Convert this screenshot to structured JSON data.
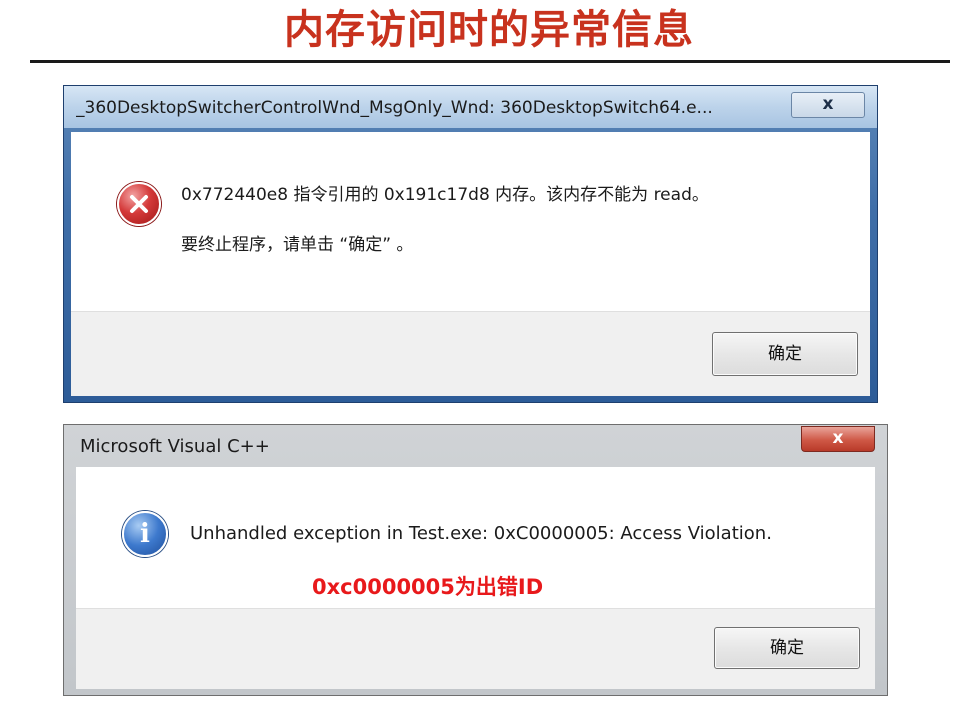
{
  "slide": {
    "title": "内存访问时的异常信息"
  },
  "dialog1": {
    "title": "_360DesktopSwitcherControlWnd_MsgOnly_Wnd: 360DesktopSwitch64.e...",
    "close_label": "x",
    "icon": "error-icon",
    "message_line1": "0x772440e8 指令引用的 0x191c17d8 内存。该内存不能为 read。",
    "message_line2": "要终止程序，请单击 “确定” 。",
    "ok_label": "确定"
  },
  "dialog2": {
    "title": "Microsoft Visual C++",
    "close_label": "x",
    "icon": "info-icon",
    "message": "Unhandled exception in Test.exe: 0xC0000005: Access Violation.",
    "ok_label": "确定",
    "annotation": "0xc0000005为出错ID"
  },
  "colors": {
    "title_red": "#c8321e",
    "annotation_red": "#e8191b"
  }
}
